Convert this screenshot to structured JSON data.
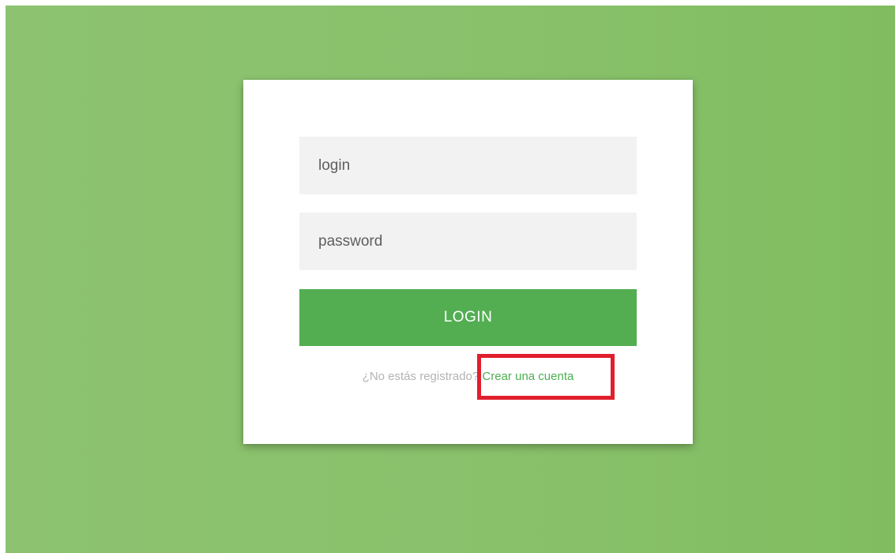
{
  "login_form": {
    "username_placeholder": "login",
    "password_placeholder": "password",
    "submit_label": "LOGIN",
    "register_prompt": "¿No estás registrado?",
    "register_link": "Crear una cuenta"
  },
  "colors": {
    "background": "#89c16b",
    "button": "#53ae52",
    "link": "#4caf50",
    "input_background": "#f2f2f2",
    "highlight": "#e11f2c"
  }
}
